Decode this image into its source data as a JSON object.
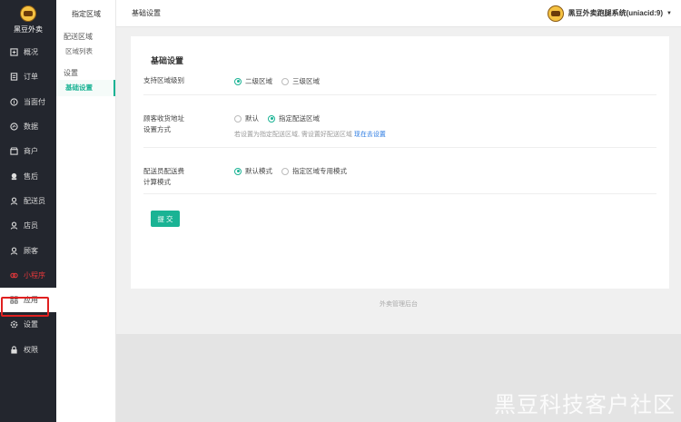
{
  "brand": {
    "name": "黑豆外卖"
  },
  "nav": [
    {
      "label": "概况",
      "icon": "dashboard-icon"
    },
    {
      "label": "订单",
      "icon": "order-icon"
    },
    {
      "label": "当面付",
      "icon": "pay-icon"
    },
    {
      "label": "数据",
      "icon": "chart-icon"
    },
    {
      "label": "商户",
      "icon": "shop-icon"
    },
    {
      "label": "售后",
      "icon": "aftersale-icon"
    },
    {
      "label": "配送员",
      "icon": "courier-icon"
    },
    {
      "label": "店员",
      "icon": "clerk-icon"
    },
    {
      "label": "顾客",
      "icon": "customer-icon"
    },
    {
      "label": "小程序",
      "icon": "miniprogram-icon"
    },
    {
      "label": "应用",
      "icon": "apps-icon"
    },
    {
      "label": "设置",
      "icon": "gear-icon"
    },
    {
      "label": "权限",
      "icon": "lock-icon"
    }
  ],
  "subnav": {
    "title": "指定区域",
    "group1": "配送区域",
    "link1": "区域列表",
    "group2": "设置",
    "link2": "基础设置"
  },
  "header": {
    "breadcrumb": "基础设置",
    "user": "黑豆外卖跑腿系统(uniacid:9)"
  },
  "form": {
    "title": "基础设置",
    "row1": {
      "label": "支持区域级别",
      "opt1": "二级区域",
      "opt2": "三级区域"
    },
    "row2": {
      "label_line1": "顾客收货地址",
      "label_line2": "设置方式",
      "opt1": "默认",
      "opt2": "指定配送区域",
      "hint": "若设置为指定配送区域, 需设置好配送区域",
      "hint_link": "现在去设置"
    },
    "row3": {
      "label_line1": "配送员配送费",
      "label_line2": "计算模式",
      "opt1": "默认模式",
      "opt2": "指定区域专用模式"
    },
    "submit": "提 交"
  },
  "footer": "外卖管理后台",
  "watermark": "黑豆科技客户社区",
  "colors": {
    "accent": "#1ab394",
    "highlight": "#e02020",
    "sidebar": "#23262e"
  }
}
